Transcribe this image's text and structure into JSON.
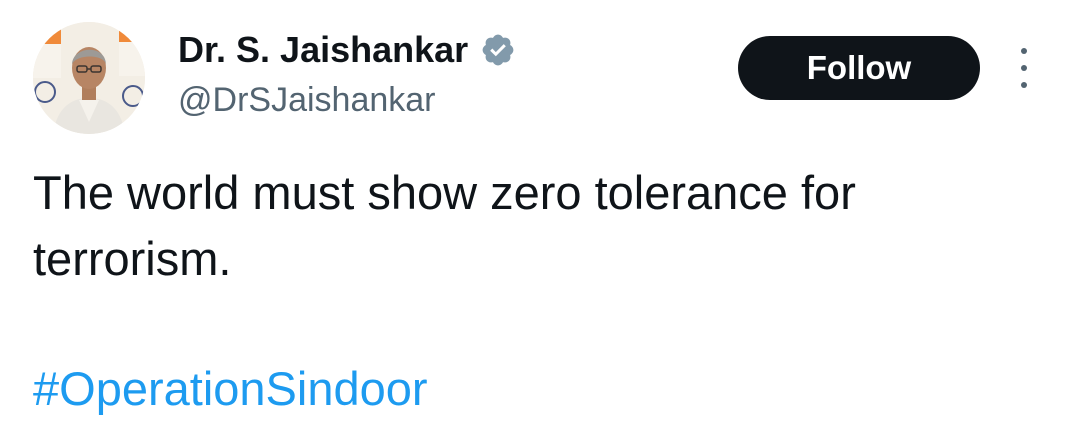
{
  "author": {
    "display_name": "Dr. S. Jaishankar",
    "handle": "@DrSJaishankar",
    "verified_icon": "verified-badge-icon",
    "verified_color": "#829aab"
  },
  "actions": {
    "follow_label": "Follow",
    "more_icon": "more-vertical-icon"
  },
  "tweet": {
    "text": "The world must show zero tolerance for terrorism.",
    "hashtag": "#OperationSindoor",
    "hashtag_color": "#1d9bf0"
  }
}
